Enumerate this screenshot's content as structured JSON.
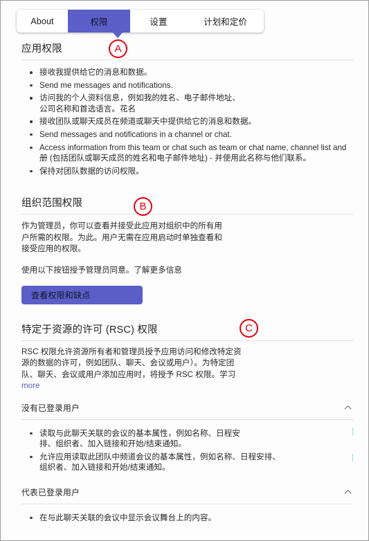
{
  "tabs": [
    {
      "label": "About",
      "active": false
    },
    {
      "label": "权限",
      "active": true
    },
    {
      "label": "设置",
      "active": false
    },
    {
      "label": "计划和定价",
      "active": false
    }
  ],
  "markers": [
    {
      "letter": "A"
    },
    {
      "letter": "B"
    },
    {
      "letter": "C"
    }
  ],
  "app_permissions": {
    "title": "应用权限",
    "items": [
      "接收我提供给它的消息和数据。",
      "Send me messages and notifications.",
      "访问我的个人资料信息，例如我的姓名、电子邮件地址、公司名称和首选语言。花名",
      "接收团队或聊天成员在频道或聊天中提供给它的消息和数据。",
      "Send messages and notifications in a channel or chat.",
      "Access information from this team or chat such as team or chat name, channel list and 册 (包括团队或聊天成员的姓名和电子邮件地址) - 并使用此名称与他们联系。",
      "保持对团队数据的访问权限。"
    ]
  },
  "org_scope": {
    "title": "组织范围权限",
    "paragraph_1": "作为管理员，你可以查看并接受此应用对组织中的所有用户所需的权限。为此。用户无需在应用启动时单独查看和接受应用的权限。",
    "paragraph_2": "使用以下按钮授予管理员同意。了解更多信息",
    "button_label": "查看权限和缺点"
  },
  "rsc": {
    "title": "特定于资源的许可 (RSC) 权限",
    "paragraph": "RSC 权限允许资源所有者和管理员授予应用访问和修改特定资源的数据的许可，例如团队、聊天、会议或用户）。为特定团队、聊天、会议或用户添加应用时，将授予 RSC 权限。学习",
    "more_link": "more",
    "groups": [
      {
        "label": "没有已登录用户",
        "expanded": true,
        "chevron": "chevron-up-icon",
        "items": [
          "读取与此聊天关联的会议的基本属性，例如名称、日程安排、组织者、加入链接和开始/结束通知。",
          "允许应用读取此团队中频道会议的基本属性，例如名称、日程安排、组织者、加入链接和开始/结束通知。"
        ]
      },
      {
        "label": "代表已登录用户",
        "expanded": true,
        "chevron": "chevron-up-icon",
        "items": [
          "在与此聊天关联的会议中显示会议舞台上的内容。"
        ]
      }
    ]
  },
  "colors": {
    "accent": "#5b5fc7",
    "marker": "#e3000f",
    "text": "#242424",
    "rule": "#e3e3e3"
  }
}
